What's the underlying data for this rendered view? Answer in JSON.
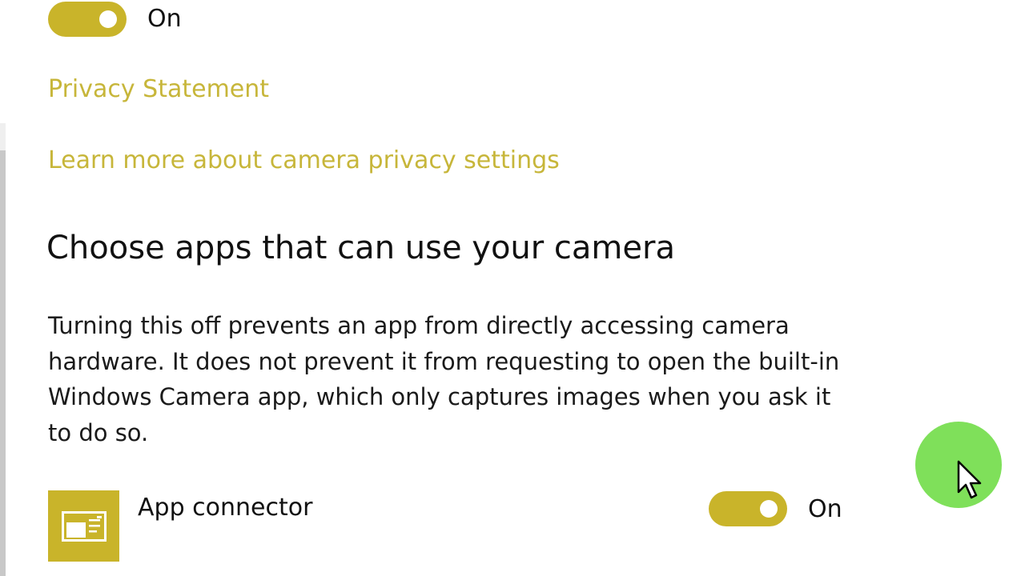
{
  "top_toggle": {
    "state_label": "On",
    "is_on": true
  },
  "links": {
    "privacy_statement": "Privacy Statement",
    "learn_more": "Learn more about camera privacy settings"
  },
  "section": {
    "heading": "Choose apps that can use your camera",
    "description": "Turning this off prevents an app from directly accessing camera hardware. It does not prevent it from requesting to open the built-in Windows Camera app, which only captures images when you ask it to do so."
  },
  "apps": [
    {
      "name": "App connector",
      "icon": "app-connector-icon",
      "toggle_label": "On",
      "is_on": true
    }
  ],
  "colors": {
    "accent": "#c9b42a",
    "link": "#c7b63a",
    "cursor_highlight": "#7fe05a"
  }
}
